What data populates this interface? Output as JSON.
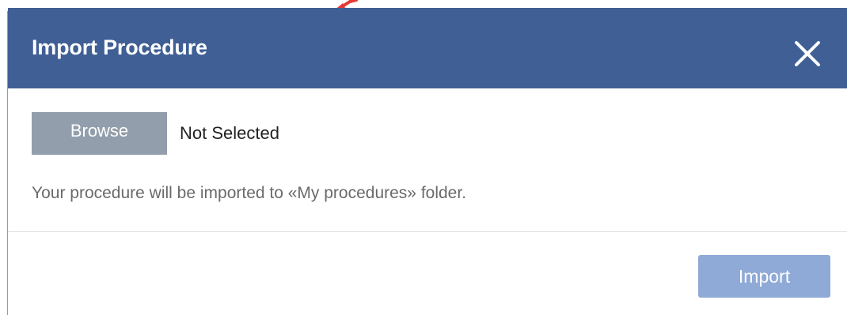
{
  "dialog": {
    "title": "Import Procedure",
    "close_icon": "close-icon",
    "file_picker": {
      "browse_label": "Browse",
      "status_text": "Not Selected"
    },
    "info_text": "Your procedure will be imported to «My procedures» folder.",
    "import_label": "Import"
  },
  "colors": {
    "header_background": "#3f5f95",
    "browse_button": "#929eab",
    "import_button_disabled": "#8faad6",
    "annotation_arrow": "#e53935"
  },
  "icons": {
    "annotation": "arrow-icon",
    "close": "close-icon"
  }
}
